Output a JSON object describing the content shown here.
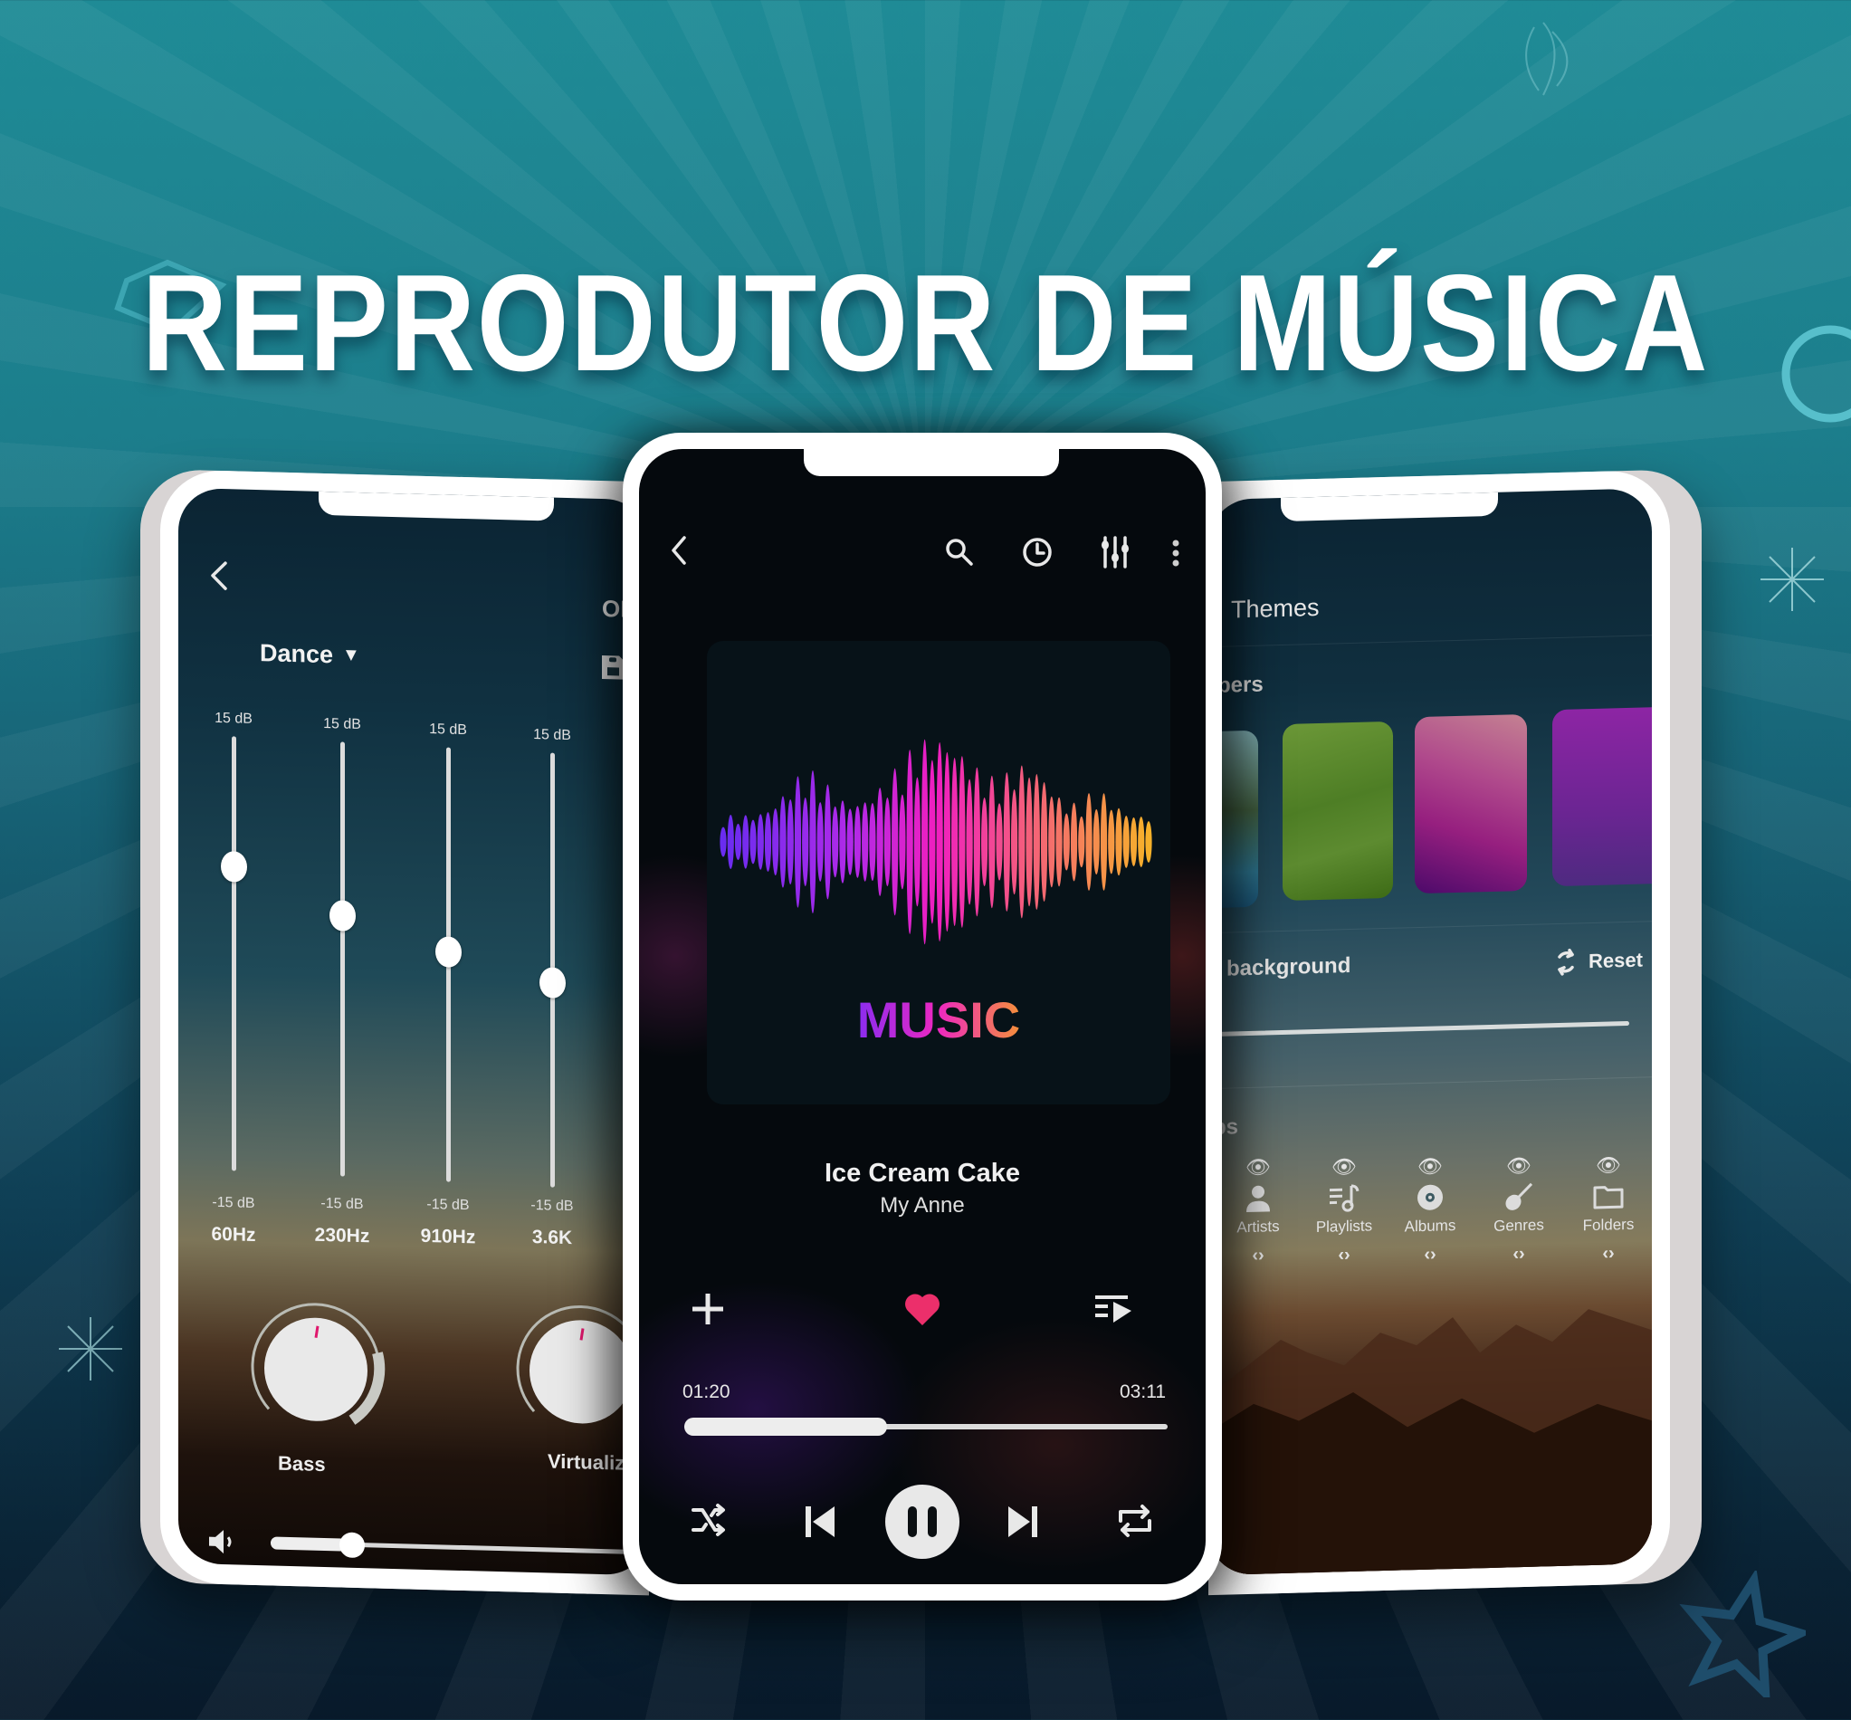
{
  "headline": "REPRODUTOR DE MÚSICA",
  "colors": {
    "accent_pink": "#ec2f6b",
    "knob_indicator": "#e0186d",
    "background_teal": "#1f8b96",
    "background_navy": "#08192a"
  },
  "equalizer_screen": {
    "back_icon": "chevron-left-icon",
    "toggle_label": "ON",
    "preset": {
      "label": "Dance",
      "dropdown_icon": "triangle-down-icon"
    },
    "save_icon": "floppy-disk-icon",
    "bands": [
      {
        "freq": "60Hz",
        "max_label": "15 dB",
        "min_label": "-15 dB",
        "level_fraction": 0.3
      },
      {
        "freq": "230Hz",
        "max_label": "15 dB",
        "min_label": "-15 dB",
        "level_fraction": 0.4
      },
      {
        "freq": "910Hz",
        "max_label": "15 dB",
        "min_label": "-15 dB",
        "level_fraction": 0.47
      },
      {
        "freq": "3.6K",
        "max_label": "15 dB",
        "min_label": "-15 dB",
        "level_fraction": 0.53
      }
    ],
    "knobs": [
      {
        "label": "Bass"
      },
      {
        "label": "Virtualizer"
      }
    ],
    "volume": {
      "icon": "speaker-icon",
      "level_fraction": 0.2
    }
  },
  "player_screen": {
    "toolbar": {
      "back_icon": "chevron-left-icon",
      "search_icon": "search-icon",
      "timer_icon": "clock-icon",
      "equalizer_icon": "equalizer-sliders-icon",
      "more_icon": "more-vertical-icon"
    },
    "album_art_text": "MUSIC",
    "track": {
      "title": "Ice Cream Cake",
      "artist": "My Anne"
    },
    "actions": {
      "add_icon": "plus-icon",
      "favorite_icon": "heart-icon",
      "queue_icon": "queue-music-icon"
    },
    "progress": {
      "elapsed": "01:20",
      "total": "03:11",
      "fraction": 0.42
    },
    "controls": {
      "shuffle_icon": "shuffle-icon",
      "previous_icon": "skip-previous-icon",
      "play_pause_icon": "pause-icon",
      "next_icon": "skip-next-icon",
      "repeat_icon": "repeat-icon"
    }
  },
  "themes_screen": {
    "title": "Themes",
    "wallpapers_label": "pers",
    "wallpapers": [
      {
        "name": "partial-blue",
        "color": "#2d6f86"
      },
      {
        "name": "green",
        "color": "#4e7e25"
      },
      {
        "name": "pink-purple",
        "color": "#a0307f"
      },
      {
        "name": "violet",
        "color": "#7a2a9e"
      }
    ],
    "background_label": "y background",
    "reset_label": "Reset",
    "reset_icon": "refresh-icon",
    "opacity_fraction": 0.0,
    "tabs_label": "bs",
    "tabs": [
      {
        "label": "Artists",
        "icon": "person-icon",
        "visible_icon": "eye-icon",
        "reorder_icon": "reorder-arrows-icon"
      },
      {
        "label": "Playlists",
        "icon": "playlist-music-icon",
        "visible_icon": "eye-icon",
        "reorder_icon": "reorder-arrows-icon"
      },
      {
        "label": "Albums",
        "icon": "disc-icon",
        "visible_icon": "eye-icon",
        "reorder_icon": "reorder-arrows-icon"
      },
      {
        "label": "Genres",
        "icon": "guitar-icon",
        "visible_icon": "eye-icon",
        "reorder_icon": "reorder-arrows-icon"
      },
      {
        "label": "Folders",
        "icon": "folder-icon",
        "visible_icon": "eye-icon",
        "reorder_icon": "reorder-arrows-icon"
      }
    ],
    "reorder_glyph": "‹›"
  }
}
